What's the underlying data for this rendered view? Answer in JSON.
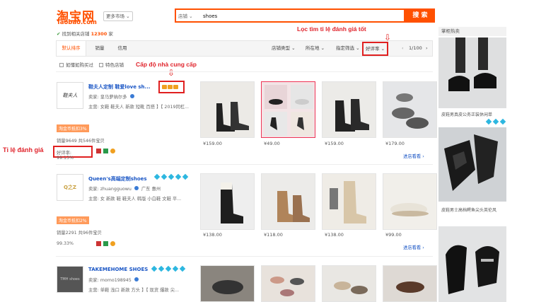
{
  "header": {
    "logo_cn": "淘宝网",
    "logo_en": "Taobao.com",
    "market": "更多市场",
    "stores_prefix": "找到相关店铺",
    "stores_count": "12300",
    "stores_suffix": "家",
    "search_category": "店铺",
    "search_value": "shoes",
    "search_button": "搜 索"
  },
  "annotations": {
    "filter_rating": "Lọc tìm tỉ lệ đánh giá tốt",
    "seller_level": "Cấp độ nhà cung cấp",
    "rating_rate": "Tỉ lệ đánh giá"
  },
  "toolbar": {
    "tabs": [
      "默认排序",
      "销量",
      "信用"
    ],
    "dropdowns": [
      "店铺类型",
      "所在地",
      "指定筛选",
      "好评率"
    ],
    "page": "1/100",
    "options": [
      "如懂如购买过",
      "特色店铺"
    ]
  },
  "shops": [
    {
      "logo": "鞋夫人",
      "name": "鞋夫人定制 鞋爱love sh...",
      "seller": "卖家: 皇马萝纳尔多",
      "main": "主营: 女鞋 鞋夫人 新款 短靴 百搭 】【 2019同杠...",
      "tag": "淘金币抵扣3%",
      "sales": "销量9649",
      "items": "共546件宝贝",
      "rate": "好评率: 99.13%",
      "more": "进店看看 ›",
      "prices": [
        "¥159.00",
        "¥49.00",
        "¥159.00",
        "¥179.00"
      ]
    },
    {
      "logo": "Q之Z",
      "name": "Queen's高端定制shoes",
      "seller": "卖家: zhuangguowu",
      "location": "广东 惠州",
      "main": "主营: 女 新款 鞋 鞋夫人 韩版 小白鞋 文鞋 平...",
      "tag": "淘金币抵扣2%",
      "sales": "销量2291",
      "items": "共96件宝贝",
      "rate": "99.33%",
      "more": "进店看看 ›",
      "prices": [
        "¥138.00",
        "¥118.00",
        "¥138.00",
        "¥99.00"
      ]
    },
    {
      "logo": "TMH shoes",
      "name": "TAKEMEHOME SHOES",
      "seller": "卖家: momo198945",
      "main": "主营: 单鞋 浅口 新款 方头 】【 现货 爆款 尖...",
      "prices": []
    }
  ],
  "sidebar": {
    "title": "掌柜热卖",
    "captions": [
      "皮鞋男真皮公务正装休闲单",
      "皮鞋男士高档鳄鱼尖头英伦风"
    ]
  }
}
